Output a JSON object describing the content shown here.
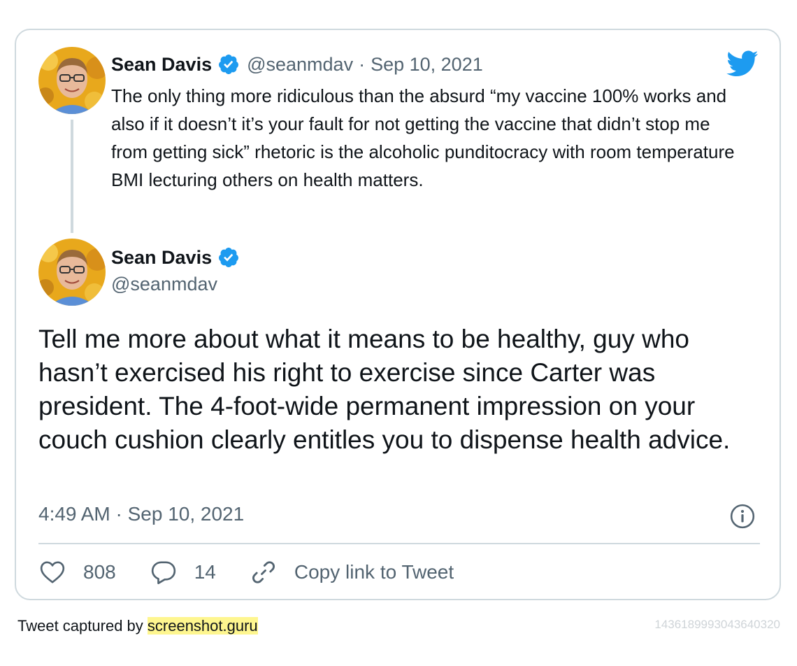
{
  "colors": {
    "accent": "#1d9bf0",
    "secondary_text": "#536471",
    "border": "#cfd9de"
  },
  "parent_tweet": {
    "author_name": "Sean Davis",
    "handle": "@seanmdav",
    "separator": "·",
    "date": "Sep 10, 2021",
    "text": "The only thing more ridiculous than the absurd “my vaccine 100% works and also if it doesn’t it’s your fault for not getting the vaccine that didn’t stop me from getting sick” rhetoric is the alcoholic punditocracy with room temperature BMI lecturing others on health matters.",
    "avatar_icon": "user-avatar",
    "verified_icon": "verified-badge-icon"
  },
  "main_tweet": {
    "author_name": "Sean Davis",
    "handle": "@seanmdav",
    "text": "Tell me more about what it means to be healthy, guy who hasn’t exercised his right to exercise since Carter was president. The 4-foot-wide permanent impression on your couch cushion clearly entitles you to dispense health advice.",
    "timestamp": "4:49 AM · Sep 10, 2021",
    "avatar_icon": "user-avatar",
    "verified_icon": "verified-badge-icon"
  },
  "actions": {
    "likes": "808",
    "replies": "14",
    "copy_link": "Copy link to Tweet"
  },
  "footer": {
    "captured_prefix": "Tweet captured by ",
    "captured_link": "screenshot.guru",
    "tweet_id": "1436189993043640320"
  }
}
